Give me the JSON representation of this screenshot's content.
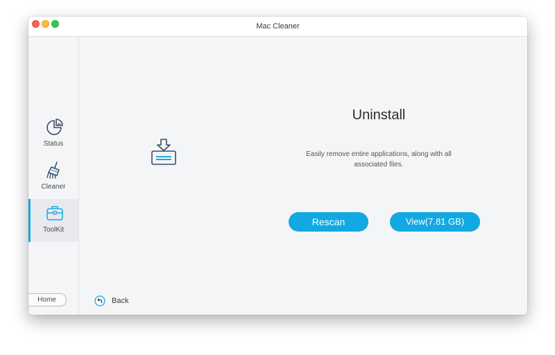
{
  "window": {
    "title": "Mac Cleaner"
  },
  "sidebar": {
    "items": [
      {
        "label": "Status",
        "icon": "pie-chart-icon",
        "active": false
      },
      {
        "label": "Cleaner",
        "icon": "broom-icon",
        "active": false
      },
      {
        "label": "ToolKit",
        "icon": "toolbox-icon",
        "active": true
      }
    ],
    "home_label": "Home"
  },
  "main": {
    "feature_icon": "uninstall-icon",
    "heading": "Uninstall",
    "description": "Easily remove entire applications, along with all associated files.",
    "rescan_label": "Rescan",
    "view_label": "View(7.81 GB)",
    "back_label": "Back"
  },
  "colors": {
    "accent": "#12a9e2",
    "icon_stroke": "#3d4a66",
    "icon_highlight": "#1fa8e6",
    "traffic_close": "#fc605b",
    "traffic_min": "#fdbc40",
    "traffic_max": "#34c84a"
  }
}
